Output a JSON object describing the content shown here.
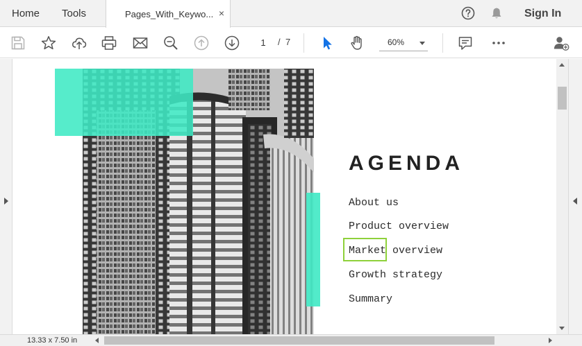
{
  "tabs": {
    "home": "Home",
    "tools": "Tools",
    "document": "Pages_With_Keywo...",
    "close_glyph": "×",
    "sign_in": "Sign In"
  },
  "toolbar": {
    "icons": [
      "save-icon",
      "star-icon",
      "cloud-upload-icon",
      "print-icon",
      "mail-icon",
      "zoom-search-icon",
      "page-up-icon",
      "page-down-icon",
      "select-cursor-icon",
      "hand-icon",
      "comment-icon",
      "more-icon",
      "add-user-icon"
    ],
    "page_current": "1",
    "page_separator": "/",
    "page_total": "7",
    "zoom": "60%"
  },
  "document": {
    "agenda_title": "AGENDA",
    "agenda_items": [
      "About us",
      "Product overview",
      "Market overview",
      "Growth strategy",
      "Summary"
    ],
    "accent_color": "#3fe9c4",
    "highlight_color": "#8ed13a"
  },
  "status": {
    "page_size": "13.33 x 7.50 in"
  }
}
